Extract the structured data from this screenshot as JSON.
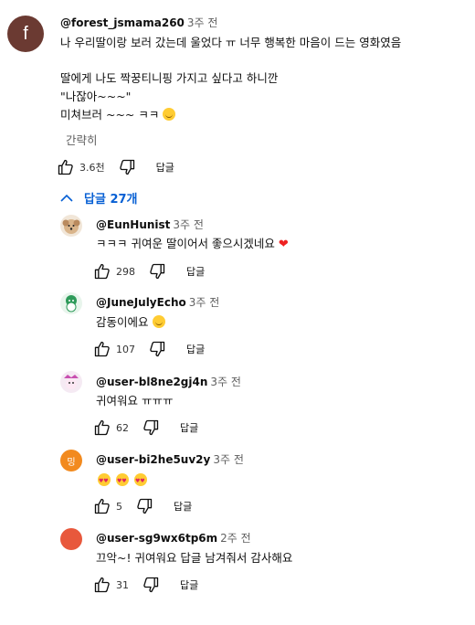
{
  "comment": {
    "avatar_letter": "f",
    "author": "@forest_jsmama260",
    "time": "3주 전",
    "lines": [
      "나 우리딸이랑 보러 갔는데 울었다 ㅠ 너무 행복한 마음이 드는 영화였음",
      "딸에게 나도 짝꿍티니핑 가지고 싶다고 하니깐",
      "\"나잖아~~~\"",
      "미쳐브러 ~~~ ㅋㅋ"
    ],
    "collapse_label": "간략히",
    "likes": "3.6천",
    "reply_label": "답글"
  },
  "replies_toggle": "답글 27개",
  "replies": [
    {
      "author": "@EunHunist",
      "time": "3주 전",
      "text": "ㅋㅋㅋ 귀여운 딸이어서 좋으시겠네요",
      "likes": "298",
      "reply_label": "답글",
      "avatar_color": "#f1e6d8"
    },
    {
      "author": "@JuneJulyEcho",
      "time": "3주 전",
      "text": "감동이에요",
      "likes": "107",
      "reply_label": "답글",
      "avatar_color": "#e8f5ec"
    },
    {
      "author": "@user-bl8ne2gj4n",
      "time": "3주 전",
      "text": "귀여워요 ㅠㅠㅠ",
      "likes": "62",
      "reply_label": "답글",
      "avatar_color": "#f5eaf3"
    },
    {
      "author": "@user-bi2he5uv2y",
      "time": "3주 전",
      "text": "",
      "likes": "5",
      "reply_label": "답글",
      "avatar_color": "#f28a1e",
      "avatar_letter": "밍"
    },
    {
      "author": "@user-sg9wx6tp6m",
      "time": "2주 전",
      "text": "끄악~! 귀여워요 답글 남겨줘서 감사해요",
      "likes": "31",
      "reply_label": "답글",
      "avatar_color": "#e8583c"
    }
  ],
  "colors": {
    "link_blue": "#065fd4",
    "muted": "#606060"
  },
  "icons": [
    "thumb-up-icon",
    "thumb-down-icon",
    "chevron-up-icon",
    "heart-icon",
    "smile-emoji-icon",
    "heart-eyes-emoji-icon"
  ]
}
